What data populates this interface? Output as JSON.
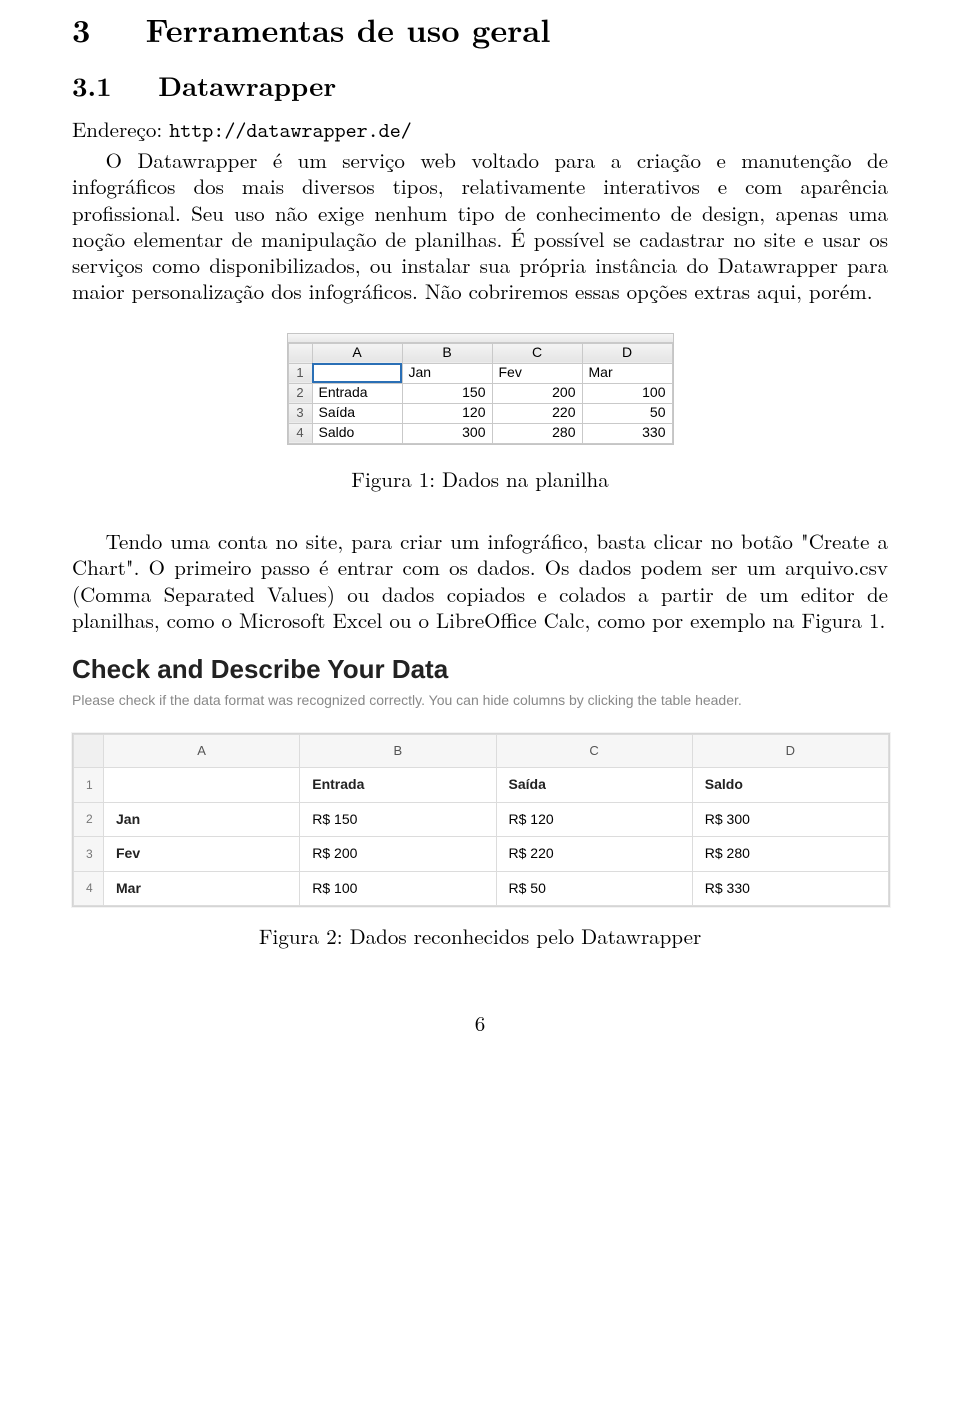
{
  "section": {
    "number": "3",
    "title": "Ferramentas de uso geral"
  },
  "subsection": {
    "number": "3.1",
    "title": "Datawrapper"
  },
  "address": {
    "label": "Endereço:",
    "url": "http://datawrapper.de/"
  },
  "paragraph1": "O Datawrapper é um serviço web voltado para a criação e manutenção de infográficos dos mais diversos tipos, relativamente interativos e com aparência profissional. Seu uso não exige nenhum tipo de conhecimento de design, apenas uma noção elementar de manipulação de planilhas. É possível se cadastrar no site e usar os serviços como disponibilizados, ou instalar sua própria instância do Datawrapper para maior personalização dos infográficos. Não cobriremos essas opções extras aqui, porém.",
  "figure1": {
    "caption": "Figura 1: Dados na planilha",
    "columns": [
      "A",
      "B",
      "C",
      "D"
    ],
    "row_idx": [
      "1",
      "2",
      "3",
      "4"
    ],
    "header_row": [
      "",
      "Jan",
      "Fev",
      "Mar"
    ],
    "rows": [
      {
        "label": "Entrada",
        "b": "150",
        "c": "200",
        "d": "100"
      },
      {
        "label": "Saída",
        "b": "120",
        "c": "220",
        "d": "50"
      },
      {
        "label": "Saldo",
        "b": "300",
        "c": "280",
        "d": "330"
      }
    ]
  },
  "paragraph2": "Tendo uma conta no site, para criar um infográfico, basta clicar no botão \"Create a Chart\". O primeiro passo é entrar com os dados. Os dados podem ser um arquivo.csv (Comma Separated Values) ou dados copiados e colados a partir de um editor de planilhas, como o Microsoft Excel ou o LibreOffice Calc, como por exemplo na Figura 1.",
  "figure2": {
    "heading": "Check and Describe Your Data",
    "subheading": "Please check if the data format was recognized correctly. You can hide columns by clicking the table header.",
    "columns": [
      "A",
      "B",
      "C",
      "D"
    ],
    "row_idx": [
      "1",
      "2",
      "3",
      "4"
    ],
    "rows": [
      {
        "a": "",
        "b": "Entrada",
        "c": "Saída",
        "d": "Saldo",
        "bold": true
      },
      {
        "a": "Jan",
        "b": "R$ 150",
        "c": "R$ 120",
        "d": "R$ 300"
      },
      {
        "a": "Fev",
        "b": "R$ 200",
        "c": "R$ 220",
        "d": "R$ 280"
      },
      {
        "a": "Mar",
        "b": "R$ 100",
        "c": "R$ 50",
        "d": "R$ 330"
      }
    ],
    "caption": "Figura 2: Dados reconhecidos pelo Datawrapper"
  },
  "page_number": "6"
}
